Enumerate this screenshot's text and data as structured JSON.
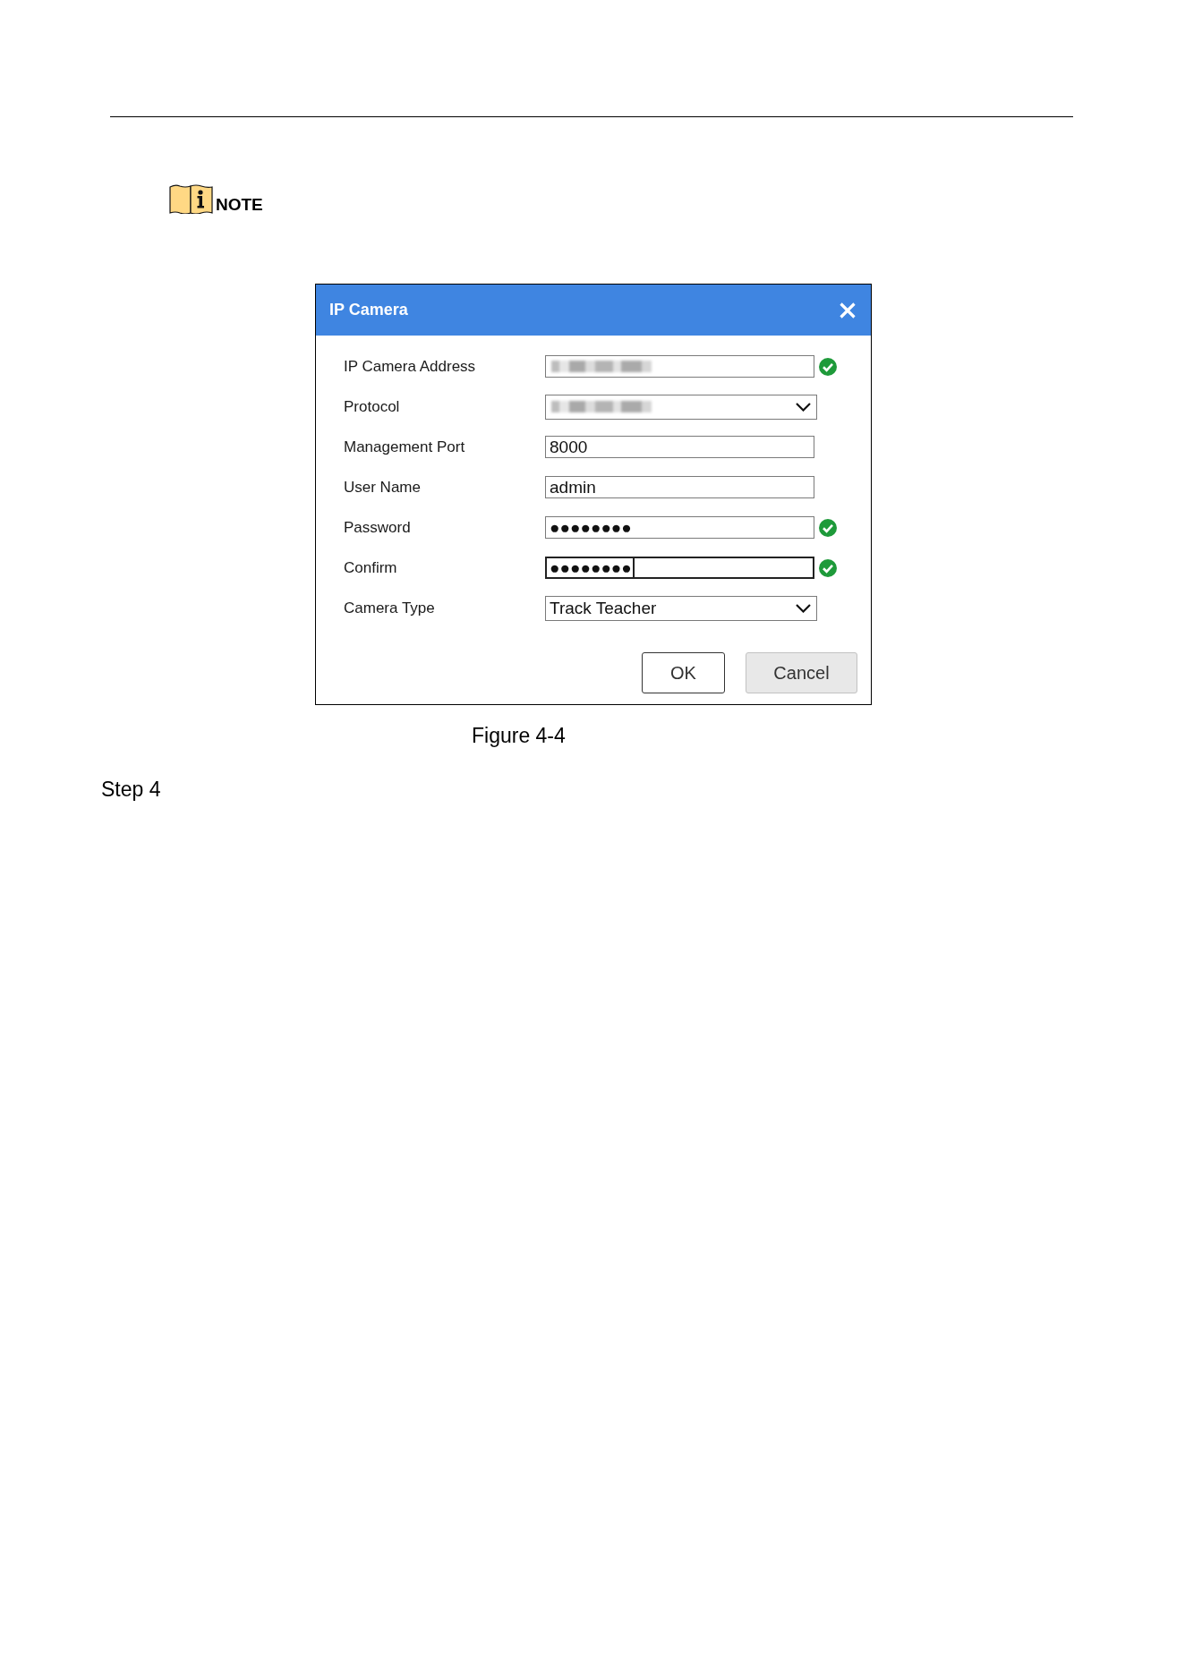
{
  "note": {
    "label": "NOTE"
  },
  "dialog": {
    "title": "IP Camera",
    "fields": [
      {
        "label": "IP Camera Address",
        "kind": "text",
        "blurred": true,
        "valid": true,
        "focused": false
      },
      {
        "label": "Protocol",
        "kind": "select",
        "blurred": true,
        "valid": false,
        "focused": false
      },
      {
        "label": "Management Port",
        "kind": "text",
        "value": "8000",
        "blurred": false,
        "valid": false,
        "focused": false
      },
      {
        "label": "User Name",
        "kind": "text",
        "value": "admin",
        "blurred": false,
        "valid": false,
        "focused": false
      },
      {
        "label": "Password",
        "kind": "password",
        "value": "●●●●●●●●",
        "blurred": false,
        "valid": true,
        "focused": false
      },
      {
        "label": "Confirm",
        "kind": "password",
        "value": "●●●●●●●●",
        "blurred": false,
        "valid": true,
        "focused": true
      },
      {
        "label": "Camera Type",
        "kind": "select",
        "value": "Track Teacher",
        "blurred": false,
        "valid": false,
        "focused": false
      }
    ],
    "buttons": [
      {
        "label": "OK",
        "kind": "confirm"
      },
      {
        "label": "Cancel",
        "kind": "cancel"
      }
    ]
  },
  "caption": "Figure 4-4",
  "step": "Step 4"
}
